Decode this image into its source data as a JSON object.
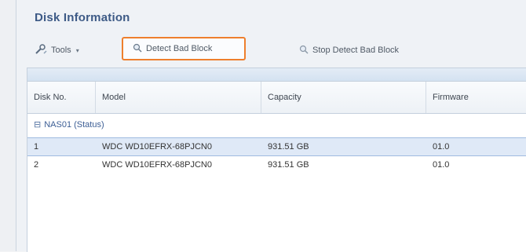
{
  "panel": {
    "title": "Disk Information"
  },
  "toolbar": {
    "tools_label": "Tools",
    "detect_label": "Detect Bad Block",
    "stop_label": "Stop Detect Bad Block"
  },
  "grid": {
    "columns": [
      "Disk No.",
      "Model",
      "Capacity",
      "Firmware"
    ],
    "group": {
      "toggle": "⊟",
      "label": "NAS01 (Status)"
    },
    "rows": [
      {
        "disk_no": "1",
        "model": "WDC WD10EFRX-68PJCN0",
        "capacity": "931.51 GB",
        "firmware": "01.0"
      },
      {
        "disk_no": "2",
        "model": "WDC WD10EFRX-68PJCN0",
        "capacity": "931.51 GB",
        "firmware": "01.0"
      }
    ]
  },
  "colors": {
    "title": "#3d5a86",
    "highlight_border": "#ee7f2d",
    "selection": "#dfe9f7"
  },
  "icons": {
    "tools": "tools-icon",
    "detect": "magnifier-icon",
    "stop": "magnifier-icon"
  }
}
